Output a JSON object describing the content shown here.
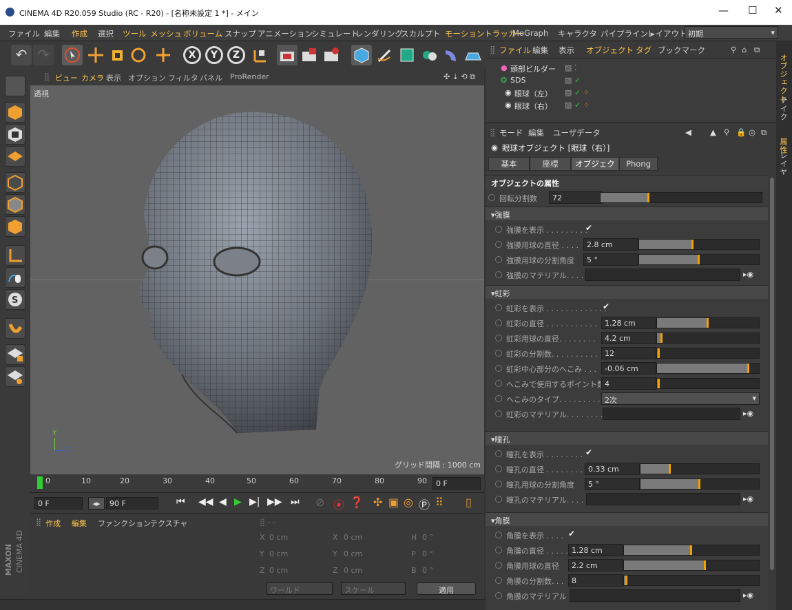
{
  "window": {
    "title": "CINEMA 4D R20.059 Studio (RC - R20) - [名称未設定 1 *] - メイン",
    "minimize": "—",
    "maximize": "☐",
    "close": "✕"
  },
  "menubar": {
    "items": [
      "ファイル",
      "編集",
      "作成",
      "選択",
      "ツール",
      "メッシュ",
      "ボリューム",
      "スナップ",
      "アニメーション",
      "シミュレート",
      "レンダリング",
      "スカルプト",
      "モーショントラッカー",
      "MoGraph",
      "キャラクタ",
      "パイプライン ▸",
      "レイアウト:"
    ],
    "layout_value": "初期"
  },
  "viewport": {
    "menu": [
      "ビュー",
      "カメラ",
      "表示",
      "オプション",
      "フィルタ",
      "パネル",
      "ProRender"
    ],
    "projection": "透視",
    "grid_label": "グリッド間隔 : 1000 cm",
    "axis_y": "Y",
    "axis_z": "Z"
  },
  "timeline": {
    "ticks": [
      "0",
      "10",
      "20",
      "30",
      "40",
      "50",
      "60",
      "70",
      "80",
      "90"
    ],
    "current_frame": "0 F",
    "start_frame": "0 F",
    "end_frame": "90 F"
  },
  "material_manager": {
    "menu": [
      "作成",
      "編集",
      "ファンクション",
      "テクスチャ"
    ]
  },
  "coordinates": {
    "x": "0 cm",
    "y": "0 cm",
    "z": "0 cm",
    "x2": "0 cm",
    "y2": "0 cm",
    "z2": "0 cm",
    "h": "0 °",
    "p": "0 °",
    "b": "0 °",
    "labels": {
      "x": "X",
      "y": "Y",
      "z": "Z",
      "h": "H",
      "p": "P",
      "b": "B"
    },
    "mode1": "ワールド",
    "mode2": "スケール",
    "apply": "適用"
  },
  "object_manager": {
    "menu": [
      "ファイル",
      "編集",
      "表示",
      "オブジェクト",
      "タグ",
      "ブックマーク"
    ],
    "objects": [
      {
        "name": "頭部ビルダー",
        "indent": 0
      },
      {
        "name": "SDS",
        "indent": 1
      },
      {
        "name": "眼球（左）",
        "indent": 2
      },
      {
        "name": "眼球（右）",
        "indent": 2
      }
    ]
  },
  "right_tabs": [
    "オブジェクト",
    "テイク",
    "属性",
    "レイヤ"
  ],
  "attribute_manager": {
    "menu": [
      "モード",
      "編集",
      "ユーザデータ"
    ],
    "title": "眼球オブジェクト [眼球（右）]",
    "tabs": [
      "基本",
      "座標",
      "オブジェクト",
      "Phong"
    ],
    "active_tab": "オブジェクト",
    "section_title": "オブジェクトの属性",
    "rotation_segments": {
      "label": "回転分割数",
      "value": "72",
      "level": 0.3
    },
    "sclera": {
      "header": "▾強膜",
      "show": "強膜を表示 . . . . . . . . .",
      "diameter_label": "強膜用球の直径 . . . .",
      "diameter": "2.8 cm",
      "diameter_level": 0.45,
      "angle_label": "強膜用球の分割角度",
      "angle": "5 °",
      "angle_level": 0.5,
      "material_label": "強膜のマテリアル. . . . ."
    },
    "iris": {
      "header": "▾虹彩",
      "show": "虹彩を表示 . . . . . . . . . . . . .",
      "diameter_label": "虹彩の直径 . . . . . . . . . . .",
      "diameter": "1.28 cm",
      "diameter_level": 0.5,
      "sphere_label": "虹彩用球の直径. . . . . . . .",
      "sphere": "4.2 cm",
      "sphere_level": 0.05,
      "segments_label": "虹彩の分割数. . . . . . . . . .",
      "segments": "12",
      "segments_level": 0.02,
      "dent_label": "虹彩中心部分のへこみ . . .",
      "dent": "-0.06 cm",
      "dent_level": 0.9,
      "points_label": "へこみで使用するポイント数",
      "points": "4",
      "points_level": 0.02,
      "type_label": "へこみのタイプ. . . . . . . . . . .",
      "type": "2次",
      "material_label": "虹彩のマテリアル. . . . . . . . ."
    },
    "pupil": {
      "header": "▾瞳孔",
      "show": "瞳孔を表示 . . . . . . . .",
      "diameter_label": "瞳孔の直径 . . . . . . . . .",
      "diameter": "0.33 cm",
      "diameter_level": 0.25,
      "angle_label": "瞳孔用球の分割角度",
      "angle": "5 °",
      "angle_level": 0.5,
      "material_label": "瞳孔のマテリアル. . . . ."
    },
    "cornea": {
      "header": "▾角膜",
      "show": "角膜を表示 . . . .",
      "diameter_label": "角膜の直径 . . . . . . .",
      "diameter": "1.28 cm",
      "diameter_level": 0.5,
      "sphere_label": "角膜用球の直径",
      "sphere": "2.2 cm",
      "sphere_level": 0.6,
      "segments_label": "角膜の分割数. . .",
      "segments": "8",
      "segments_level": 0.02,
      "material_label": "角膜のマテリアル"
    }
  },
  "branding": {
    "maxon": "MAXON",
    "c4d": "CINEMA 4D"
  }
}
